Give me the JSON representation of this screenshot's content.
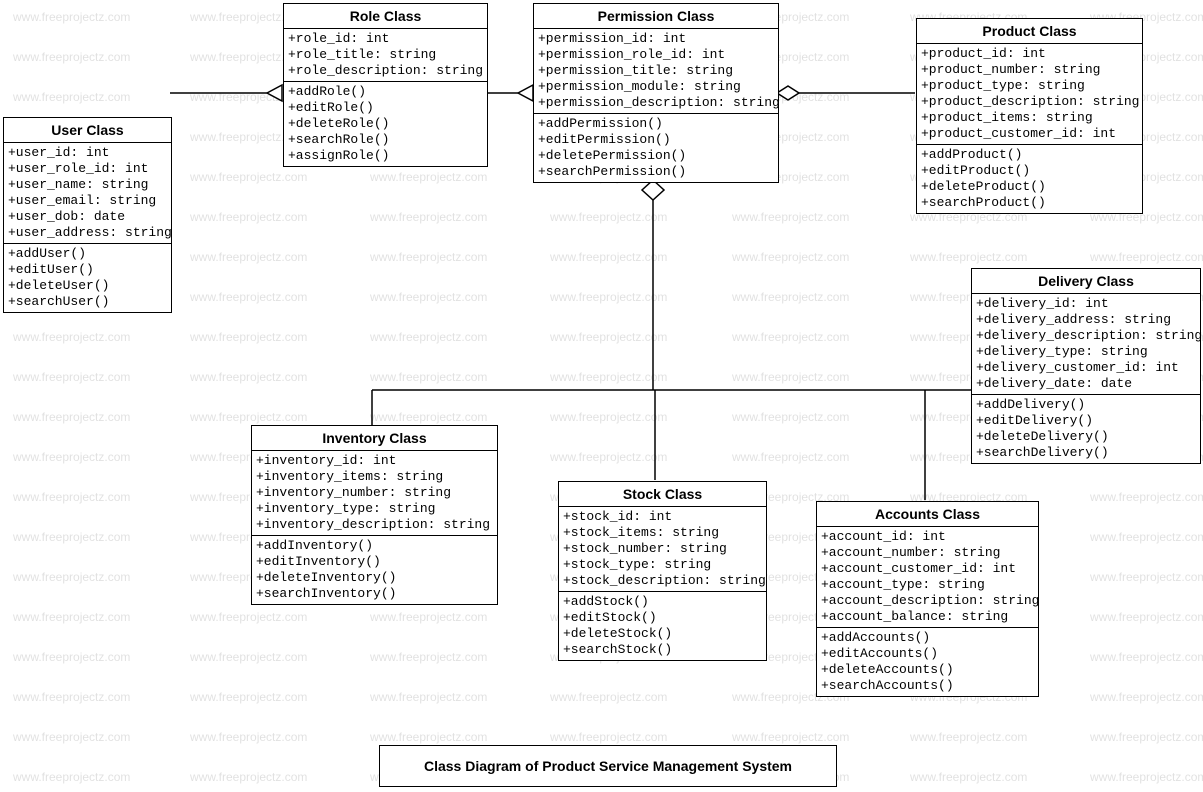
{
  "watermark_text": "www.freeprojectz.com",
  "diagram_title": "Class Diagram of Product Service Management System",
  "classes": {
    "user": {
      "title": "User Class",
      "attrs": [
        "+user_id: int",
        "+user_role_id: int",
        "+user_name: string",
        "+user_email: string",
        "+user_dob: date",
        "+user_address: string"
      ],
      "methods": [
        "+addUser()",
        "+editUser()",
        "+deleteUser()",
        "+searchUser()"
      ]
    },
    "role": {
      "title": "Role Class",
      "attrs": [
        "+role_id: int",
        "+role_title: string",
        "+role_description: string"
      ],
      "methods": [
        "+addRole()",
        "+editRole()",
        "+deleteRole()",
        "+searchRole()",
        "+assignRole()"
      ]
    },
    "permission": {
      "title": "Permission Class",
      "attrs": [
        "+permission_id: int",
        "+permission_role_id: int",
        "+permission_title: string",
        "+permission_module: string",
        "+permission_description: string"
      ],
      "methods": [
        "+addPermission()",
        "+editPermission()",
        "+deletePermission()",
        "+searchPermission()"
      ]
    },
    "product": {
      "title": "Product Class",
      "attrs": [
        "+product_id: int",
        "+product_number: string",
        "+product_type: string",
        "+product_description: string",
        "+product_items: string",
        "+product_customer_id: int"
      ],
      "methods": [
        "+addProduct()",
        "+editProduct()",
        "+deleteProduct()",
        "+searchProduct()"
      ]
    },
    "delivery": {
      "title": "Delivery Class",
      "attrs": [
        "+delivery_id: int",
        "+delivery_address: string",
        "+delivery_description: string",
        "+delivery_type: string",
        "+delivery_customer_id: int",
        "+delivery_date: date"
      ],
      "methods": [
        "+addDelivery()",
        "+editDelivery()",
        "+deleteDelivery()",
        "+searchDelivery()"
      ]
    },
    "inventory": {
      "title": "Inventory Class",
      "attrs": [
        "+inventory_id: int",
        "+inventory_items: string",
        "+inventory_number: string",
        "+inventory_type: string",
        "+inventory_description: string"
      ],
      "methods": [
        "+addInventory()",
        "+editInventory()",
        "+deleteInventory()",
        "+searchInventory()"
      ]
    },
    "stock": {
      "title": "Stock Class",
      "attrs": [
        "+stock_id: int",
        "+stock_items: string",
        "+stock_number: string",
        "+stock_type: string",
        "+stock_description: string"
      ],
      "methods": [
        "+addStock()",
        "+editStock()",
        "+deleteStock()",
        "+searchStock()"
      ]
    },
    "accounts": {
      "title": "Accounts Class",
      "attrs": [
        "+account_id: int",
        "+account_number: string",
        "+account_customer_id: int",
        "+account_type: string",
        "+account_description: string",
        "+account_balance: string"
      ],
      "methods": [
        "+addAccounts()",
        "+editAccounts()",
        "+deleteAccounts()",
        "+searchAccounts()"
      ]
    }
  }
}
